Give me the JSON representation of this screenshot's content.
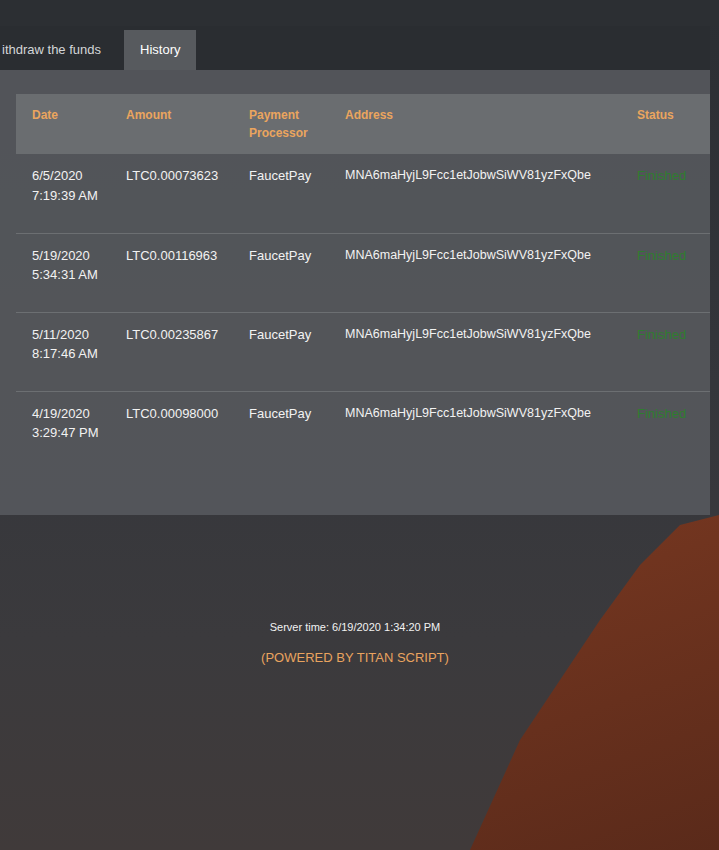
{
  "tabs": [
    {
      "label": "ithdraw the funds",
      "selected": false
    },
    {
      "label": "History",
      "selected": true
    }
  ],
  "table": {
    "columns": [
      "Date",
      "Amount",
      "Payment Processor",
      "Address",
      "Status"
    ],
    "rows": [
      {
        "date": "6/5/2020 7:19:39 AM",
        "amount": "LTC0.00073623",
        "processor": "FaucetPay",
        "address": "MNA6maHyjL9Fcc1etJobwSiWV81yzFxQbe",
        "status": "Finished"
      },
      {
        "date": "5/19/2020 5:34:31 AM",
        "amount": "LTC0.00116963",
        "processor": "FaucetPay",
        "address": "MNA6maHyjL9Fcc1etJobwSiWV81yzFxQbe",
        "status": "Finished"
      },
      {
        "date": "5/11/2020 8:17:46 AM",
        "amount": "LTC0.00235867",
        "processor": "FaucetPay",
        "address": "MNA6maHyjL9Fcc1etJobwSiWV81yzFxQbe",
        "status": "Finished"
      },
      {
        "date": "4/19/2020 3:29:47 PM",
        "amount": "LTC0.00098000",
        "processor": "FaucetPay",
        "address": "MNA6maHyjL9Fcc1etJobwSiWV81yzFxQbe",
        "status": "Finished"
      }
    ]
  },
  "footer": {
    "server_time": "Server time: 6/19/2020 1:34:20 PM",
    "powered": "(POWERED BY TITAN SCRIPT)"
  }
}
